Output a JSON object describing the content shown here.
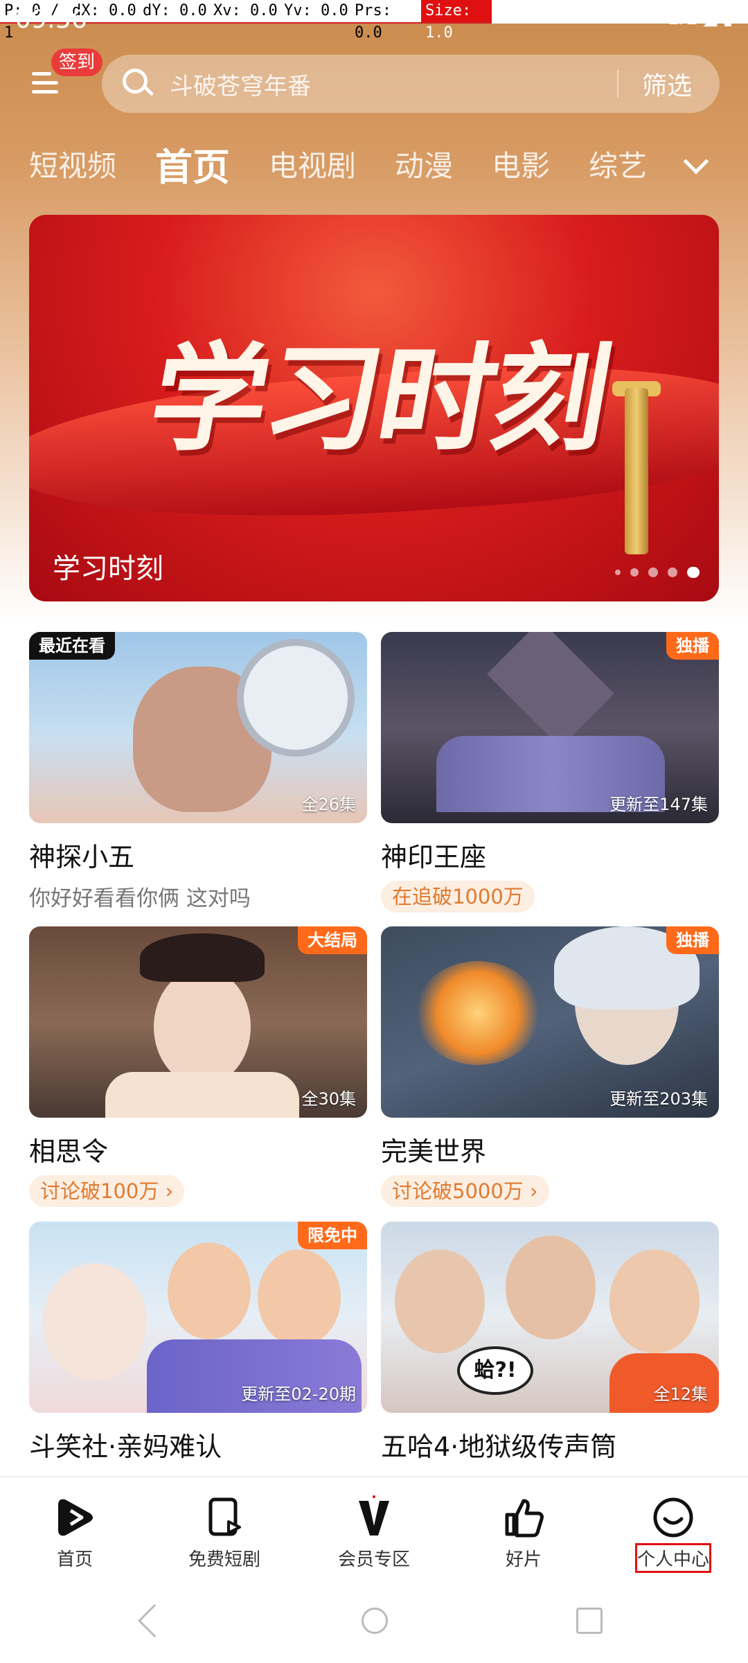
{
  "debug": {
    "p": "P: 0 / 1",
    "dx": "dX: 0.0",
    "dy": "dY: 0.0",
    "xv": "Xv: 0.0",
    "yv": "Yv: 0.0",
    "prs": "Prs: 0.0",
    "size": "Size: 1.0"
  },
  "status": {
    "time": "09:56",
    "network": "LTE"
  },
  "header": {
    "sign_badge": "签到",
    "search_placeholder": "斗破苍穹年番",
    "filter_label": "筛选"
  },
  "tabs": [
    "短视频",
    "首页",
    "电视剧",
    "动漫",
    "电影",
    "综艺"
  ],
  "active_tab": "首页",
  "banner": {
    "hero_text": "学习时刻",
    "caption": "学习时刻",
    "dot_count": 5,
    "active_dot": 5
  },
  "cards": [
    {
      "title": "神探小五",
      "subtitle": "你好好看看你俩 这对吗",
      "badge": "最近在看",
      "episodes": "全26集",
      "tag": ""
    },
    {
      "title": "神印王座",
      "subtitle": "",
      "badge": "独播",
      "episodes": "更新至147集",
      "tag": "在追破1000万"
    },
    {
      "title": "相思令",
      "subtitle": "",
      "badge": "大结局",
      "episodes": "全30集",
      "tag": "讨论破100万 ›"
    },
    {
      "title": "完美世界",
      "subtitle": "",
      "badge": "独播",
      "episodes": "更新至203集",
      "tag": "讨论破5000万 ›"
    },
    {
      "title": "斗笑社·亲妈难认",
      "subtitle": "",
      "badge": "限免中",
      "episodes": "更新至02-20期",
      "tag": ""
    },
    {
      "title": "五哈4·地狱级传声筒",
      "subtitle": "",
      "badge": "",
      "episodes": "全12集",
      "tag": "",
      "overlay_text": "蛤?!"
    }
  ],
  "bottom_nav": [
    {
      "label": "首页",
      "icon": "play-logo-icon"
    },
    {
      "label": "免费短剧",
      "icon": "short-drama-icon"
    },
    {
      "label": "会员专区",
      "icon": "vip-v-icon"
    },
    {
      "label": "好片",
      "icon": "thumbs-up-icon"
    },
    {
      "label": "个人中心",
      "icon": "smile-face-icon"
    }
  ],
  "colors": {
    "accent": "#ff6a1a",
    "header_bg": "#c98a4c",
    "tag_text": "#e07a30"
  }
}
